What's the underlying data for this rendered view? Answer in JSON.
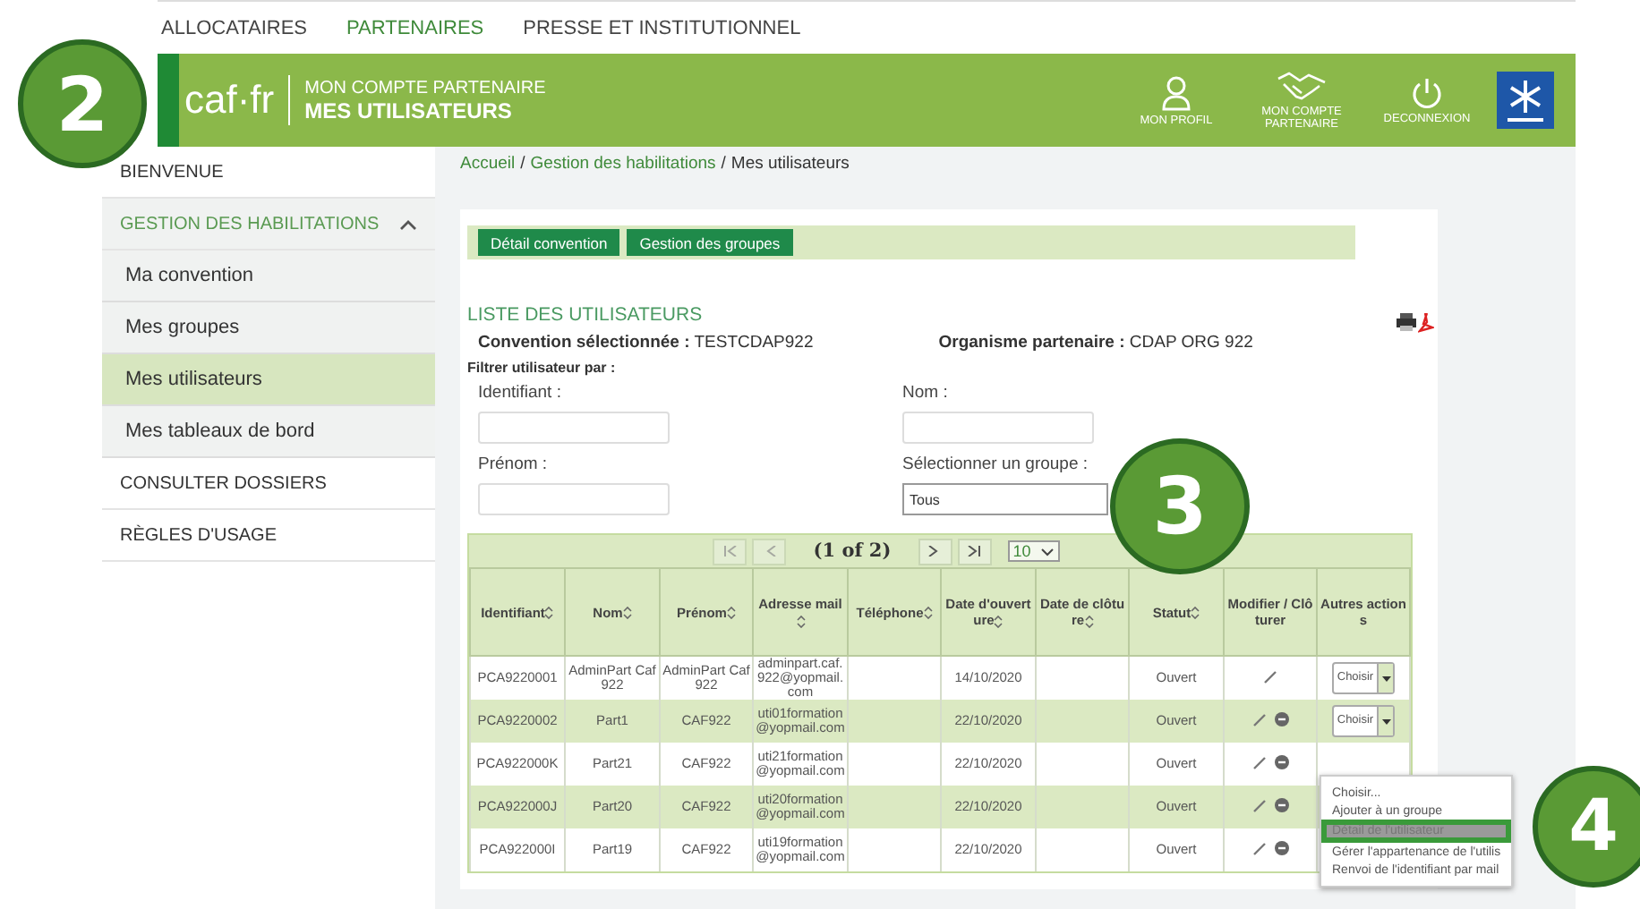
{
  "top_nav": [
    {
      "label": "ALLOCATAIRES",
      "selected": false
    },
    {
      "label": "PARTENAIRES",
      "selected": true
    },
    {
      "label": "PRESSE ET INSTITUTIONNEL",
      "selected": false
    }
  ],
  "header": {
    "logo": "caf·fr",
    "subtitle": "MON COMPTE PARTENAIRE",
    "title": "MES UTILISATEURS",
    "actions": [
      {
        "kind": "profile",
        "label": "MON PROFIL"
      },
      {
        "kind": "partner",
        "label": "MON COMPTE PARTENAIRE"
      },
      {
        "kind": "logout",
        "label": "DECONNEXION"
      }
    ]
  },
  "sidebar": [
    {
      "label": "BIENVENUE",
      "selected": false
    },
    {
      "label": "GESTION DES HABILITATIONS",
      "selected": false,
      "expanded": true,
      "children": [
        {
          "label": "Ma convention",
          "selected": false
        },
        {
          "label": "Mes groupes",
          "selected": false
        },
        {
          "label": "Mes utilisateurs",
          "selected": true
        },
        {
          "label": "Mes tableaux de bord",
          "selected": false
        }
      ]
    },
    {
      "label": "CONSULTER DOSSIERS",
      "selected": false
    },
    {
      "label": "RÈGLES D'USAGE",
      "selected": false
    }
  ],
  "breadcrumb": {
    "separator": "/",
    "items": [
      {
        "label": "Accueil",
        "link": true
      },
      {
        "label": "Gestion des habilitations",
        "link": true
      },
      {
        "label": "Mes utilisateurs",
        "link": false
      }
    ]
  },
  "tab_buttons": [
    "Détail convention",
    "Gestion des groupes"
  ],
  "section_title": "LISTE DES UTILISATEURS",
  "convention": {
    "label": "Convention sélectionnée :",
    "value": "TESTCDAP922"
  },
  "organisme": {
    "label": "Organisme partenaire :",
    "value": "CDAP ORG 922"
  },
  "filter_title": "Filtrer utilisateur par :",
  "fields": [
    {
      "label": "Identifiant :",
      "kind": "text"
    },
    {
      "label": "Nom :",
      "kind": "text"
    },
    {
      "label": "Prénom :",
      "kind": "text"
    },
    {
      "label": "Sélectionner un groupe :",
      "kind": "select",
      "value": "Tous"
    }
  ],
  "pager": {
    "text": "(1 of 2)",
    "page_size": "10"
  },
  "columns": [
    {
      "label": "Identifiant",
      "sortable": true
    },
    {
      "label": "Nom",
      "sortable": true
    },
    {
      "label": "Prénom",
      "sortable": true
    },
    {
      "label": "Adresse mail",
      "sortable": true
    },
    {
      "label": "Téléphone",
      "sortable": true
    },
    {
      "label": "Date d'ouverture",
      "sortable": true
    },
    {
      "label": "Date de clôture",
      "sortable": true
    },
    {
      "label": "Statut",
      "sortable": true
    },
    {
      "label": "Modifier / Clôturer",
      "sortable": false
    },
    {
      "label": "Autres actions",
      "sortable": false
    }
  ],
  "rows": [
    {
      "id": "PCA9220001",
      "nom": "AdminPart Caf922",
      "prenom": "AdminPart Caf922",
      "mail": "adminpart.caf.922@yopmail.com",
      "date_ouverture": "14/10/2020",
      "statut": "Ouvert",
      "can_close": false,
      "action": "Choisir"
    },
    {
      "id": "PCA9220002",
      "nom": "Part1",
      "prenom": "CAF922",
      "mail": "uti01formation@yopmail.com",
      "date_ouverture": "22/10/2020",
      "statut": "Ouvert",
      "can_close": true,
      "action": "Choisir"
    },
    {
      "id": "PCA922000K",
      "nom": "Part21",
      "prenom": "CAF922",
      "mail": "uti21formation@yopmail.com",
      "date_ouverture": "22/10/2020",
      "statut": "Ouvert",
      "can_close": true
    },
    {
      "id": "PCA922000J",
      "nom": "Part20",
      "prenom": "CAF922",
      "mail": "uti20formation@yopmail.com",
      "date_ouverture": "22/10/2020",
      "statut": "Ouvert",
      "can_close": true
    },
    {
      "id": "PCA922000I",
      "nom": "Part19",
      "prenom": "CAF922",
      "mail": "uti19formation@yopmail.com",
      "date_ouverture": "22/10/2020",
      "statut": "Ouvert",
      "can_close": true
    }
  ],
  "action_menu": [
    {
      "label": "Choisir...",
      "selected": false
    },
    {
      "label": "Ajouter à un groupe",
      "selected": false
    },
    {
      "label": "Détail de l'utilisateur",
      "selected": true
    },
    {
      "label": "Gérer l'appartenance de l'utilis",
      "selected": false
    },
    {
      "label": "Renvoi de l'identifiant par mail",
      "selected": false
    }
  ],
  "callouts": [
    "2",
    "3",
    "4"
  ]
}
